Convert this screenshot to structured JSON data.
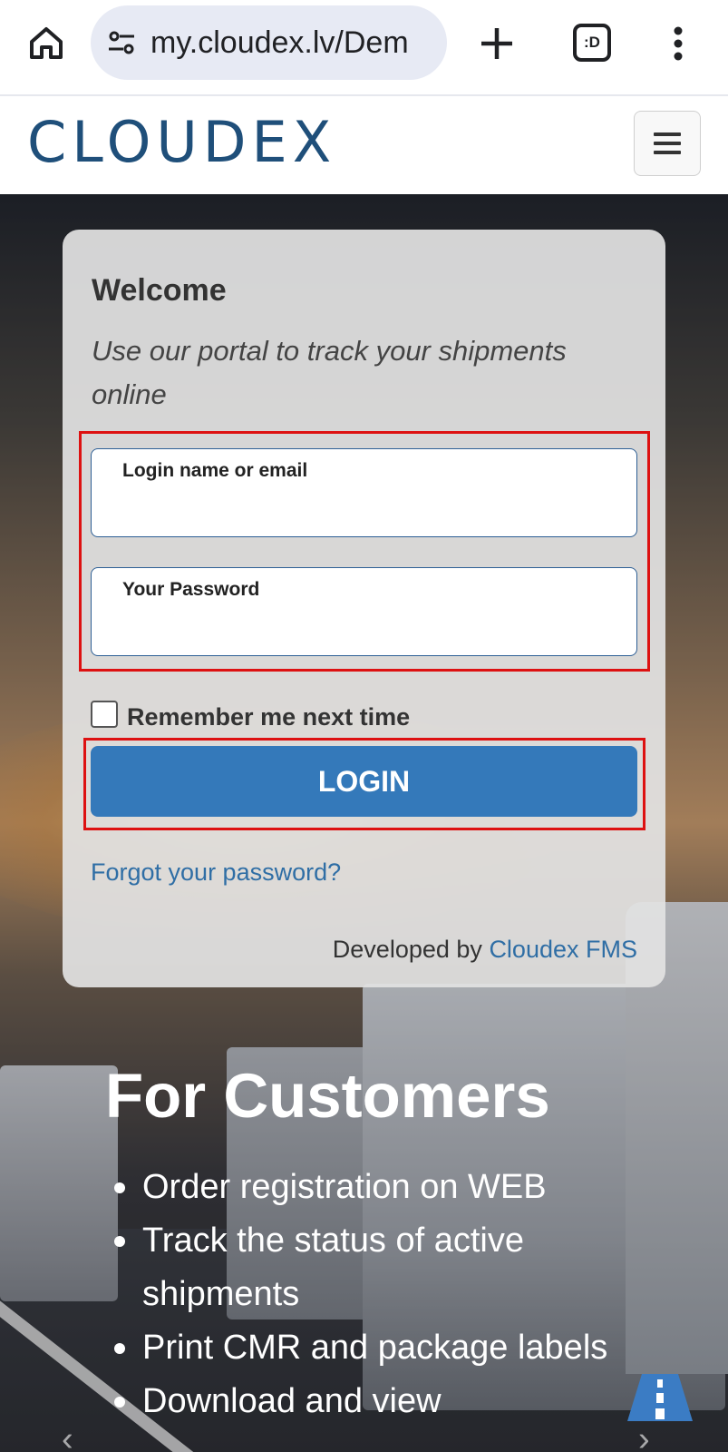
{
  "browser": {
    "url": "my.cloudex.lv/Dem",
    "tab_count_label": ":D"
  },
  "site": {
    "logo_text": "CLOUDEX"
  },
  "login_card": {
    "welcome": "Welcome",
    "subtitle": "Use our portal to track your shipments online",
    "login_field_label": "Login name or email",
    "login_field_value": "",
    "password_field_label": "Your Password",
    "password_field_value": "",
    "remember_label": "Remember me next time",
    "remember_checked": false,
    "login_button": "LOGIN",
    "forgot_link": "Forgot your password?",
    "developed_by": "Developed by",
    "developed_brand": "Cloudex FMS"
  },
  "customers": {
    "title": "For Customers",
    "items": [
      "Order registration on WEB",
      "Track the status of active shipments",
      "Print CMR and package labels",
      "Download and view"
    ]
  },
  "colors": {
    "accent": "#3479ba",
    "link": "#2f6ea5",
    "logo": "#1f4f7a",
    "highlight": "#dd1111"
  }
}
